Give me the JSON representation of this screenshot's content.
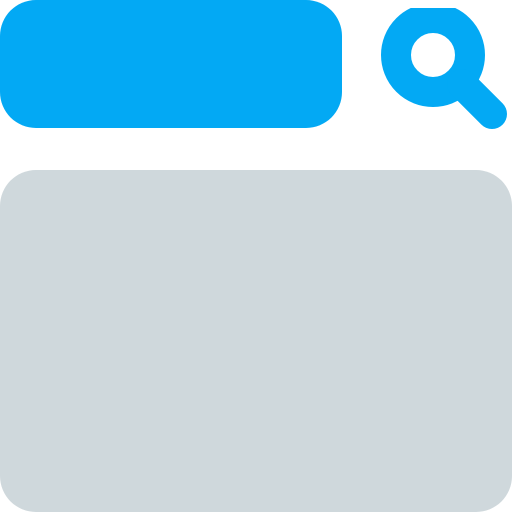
{
  "search": {
    "icon": "search-icon",
    "bar_color": "#03A9F4"
  },
  "content": {
    "panel_color": "#CFD8DC"
  }
}
